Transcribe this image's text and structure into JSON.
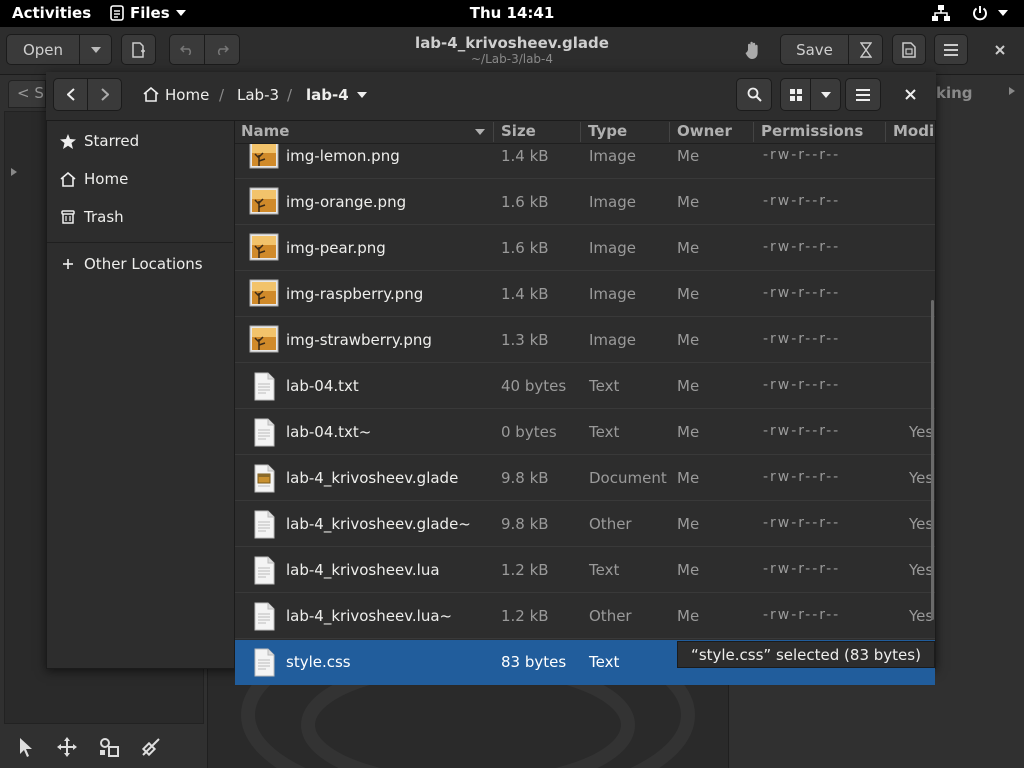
{
  "topbar": {
    "activities": "Activities",
    "app_name": "Files",
    "clock": "Thu 14:41"
  },
  "glade": {
    "open_label": "Open",
    "save_label": "Save",
    "title": "lab-4_krivosheev.glade",
    "subtitle": "~/Lab-3/lab-4",
    "tab_partial": "< S",
    "right_tab_partial": "king"
  },
  "dialog": {
    "breadcrumb": [
      "Home",
      "Lab-3",
      "lab-4"
    ],
    "sidebar": [
      {
        "label": "Starred",
        "icon": "star-icon"
      },
      {
        "label": "Home",
        "icon": "home-icon"
      },
      {
        "label": "Trash",
        "icon": "trash-icon"
      },
      {
        "label": "Other Locations",
        "icon": "plus-icon"
      }
    ],
    "columns": [
      "Name",
      "Size",
      "Type",
      "Owner",
      "Permissions",
      "Modi"
    ],
    "files": [
      {
        "name": "img-lemon.png",
        "size": "1.4 kB",
        "type": "Image",
        "owner": "Me",
        "perms": "-rw-r--r--",
        "modified": "",
        "icon": "image"
      },
      {
        "name": "img-orange.png",
        "size": "1.6 kB",
        "type": "Image",
        "owner": "Me",
        "perms": "-rw-r--r--",
        "modified": "",
        "icon": "image"
      },
      {
        "name": "img-pear.png",
        "size": "1.6 kB",
        "type": "Image",
        "owner": "Me",
        "perms": "-rw-r--r--",
        "modified": "",
        "icon": "image"
      },
      {
        "name": "img-raspberry.png",
        "size": "1.4 kB",
        "type": "Image",
        "owner": "Me",
        "perms": "-rw-r--r--",
        "modified": "",
        "icon": "image"
      },
      {
        "name": "img-strawberry.png",
        "size": "1.3 kB",
        "type": "Image",
        "owner": "Me",
        "perms": "-rw-r--r--",
        "modified": "",
        "icon": "image"
      },
      {
        "name": "lab-04.txt",
        "size": "40 bytes",
        "type": "Text",
        "owner": "Me",
        "perms": "-rw-r--r--",
        "modified": "",
        "icon": "text"
      },
      {
        "name": "lab-04.txt~",
        "size": "0 bytes",
        "type": "Text",
        "owner": "Me",
        "perms": "-rw-r--r--",
        "modified": "Yes",
        "icon": "text"
      },
      {
        "name": "lab-4_krivosheev.glade",
        "size": "9.8 kB",
        "type": "Document",
        "owner": "Me",
        "perms": "-rw-r--r--",
        "modified": "Yes",
        "icon": "glade"
      },
      {
        "name": "lab-4_krivosheev.glade~",
        "size": "9.8 kB",
        "type": "Other",
        "owner": "Me",
        "perms": "-rw-r--r--",
        "modified": "Yes",
        "icon": "text"
      },
      {
        "name": "lab-4_krivosheev.lua",
        "size": "1.2 kB",
        "type": "Text",
        "owner": "Me",
        "perms": "-rw-r--r--",
        "modified": "Yes",
        "icon": "text"
      },
      {
        "name": "lab-4_krivosheev.lua~",
        "size": "1.2 kB",
        "type": "Other",
        "owner": "Me",
        "perms": "-rw-r--r--",
        "modified": "Yes",
        "icon": "text"
      },
      {
        "name": "style.css",
        "size": "83 bytes",
        "type": "Text",
        "owner": "",
        "perms": "",
        "modified": "",
        "icon": "text",
        "selected": true
      }
    ],
    "status": "“style.css” selected (83 bytes)"
  },
  "colors": {
    "selection": "#215d9c",
    "background": "#353535",
    "topbar": "#000000"
  }
}
